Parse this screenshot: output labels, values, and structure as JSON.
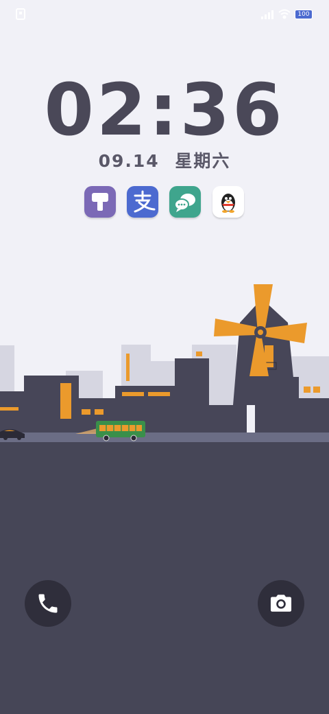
{
  "status_bar": {
    "battery_level": "100",
    "icons": [
      "notification-icon",
      "signal-icon",
      "wifi-icon",
      "battery-icon"
    ]
  },
  "lock_screen": {
    "time": "02:36",
    "date": "09.14",
    "weekday": "星期六"
  },
  "shortcuts": [
    {
      "name": "paint-brush-app",
      "color": "#7b69b6"
    },
    {
      "name": "alipay-app",
      "color": "#4c6ad0"
    },
    {
      "name": "messages-app",
      "color": "#3fa58d"
    },
    {
      "name": "qq-app",
      "color": "#ffffff"
    }
  ],
  "bottom_actions": {
    "left": "phone-icon",
    "right": "camera-icon"
  },
  "colors": {
    "background": "#f1f1f7",
    "ground": "#464657",
    "accent": "#eb9a2c",
    "bus": "#3a8f4a"
  }
}
